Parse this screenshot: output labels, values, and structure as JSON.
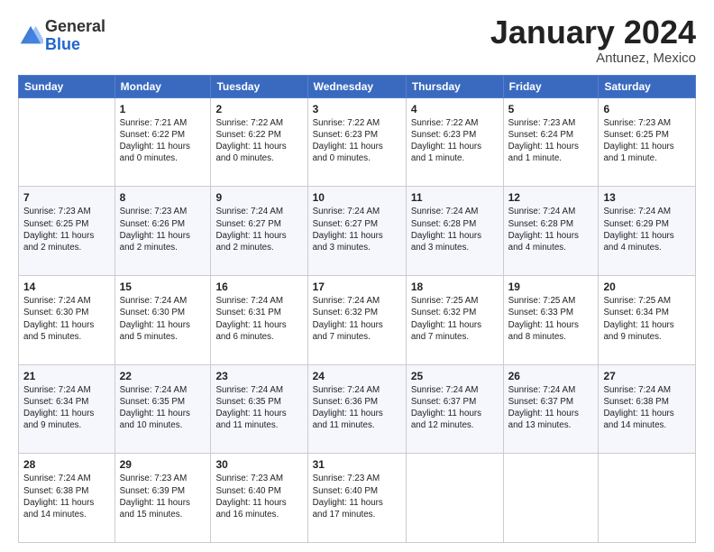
{
  "logo": {
    "general": "General",
    "blue": "Blue"
  },
  "title": "January 2024",
  "location": "Antunez, Mexico",
  "days_of_week": [
    "Sunday",
    "Monday",
    "Tuesday",
    "Wednesday",
    "Thursday",
    "Friday",
    "Saturday"
  ],
  "weeks": [
    [
      {
        "day": "",
        "info": ""
      },
      {
        "day": "1",
        "info": "Sunrise: 7:21 AM\nSunset: 6:22 PM\nDaylight: 11 hours\nand 0 minutes."
      },
      {
        "day": "2",
        "info": "Sunrise: 7:22 AM\nSunset: 6:22 PM\nDaylight: 11 hours\nand 0 minutes."
      },
      {
        "day": "3",
        "info": "Sunrise: 7:22 AM\nSunset: 6:23 PM\nDaylight: 11 hours\nand 0 minutes."
      },
      {
        "day": "4",
        "info": "Sunrise: 7:22 AM\nSunset: 6:23 PM\nDaylight: 11 hours\nand 1 minute."
      },
      {
        "day": "5",
        "info": "Sunrise: 7:23 AM\nSunset: 6:24 PM\nDaylight: 11 hours\nand 1 minute."
      },
      {
        "day": "6",
        "info": "Sunrise: 7:23 AM\nSunset: 6:25 PM\nDaylight: 11 hours\nand 1 minute."
      }
    ],
    [
      {
        "day": "7",
        "info": "Sunrise: 7:23 AM\nSunset: 6:25 PM\nDaylight: 11 hours\nand 2 minutes."
      },
      {
        "day": "8",
        "info": "Sunrise: 7:23 AM\nSunset: 6:26 PM\nDaylight: 11 hours\nand 2 minutes."
      },
      {
        "day": "9",
        "info": "Sunrise: 7:24 AM\nSunset: 6:27 PM\nDaylight: 11 hours\nand 2 minutes."
      },
      {
        "day": "10",
        "info": "Sunrise: 7:24 AM\nSunset: 6:27 PM\nDaylight: 11 hours\nand 3 minutes."
      },
      {
        "day": "11",
        "info": "Sunrise: 7:24 AM\nSunset: 6:28 PM\nDaylight: 11 hours\nand 3 minutes."
      },
      {
        "day": "12",
        "info": "Sunrise: 7:24 AM\nSunset: 6:28 PM\nDaylight: 11 hours\nand 4 minutes."
      },
      {
        "day": "13",
        "info": "Sunrise: 7:24 AM\nSunset: 6:29 PM\nDaylight: 11 hours\nand 4 minutes."
      }
    ],
    [
      {
        "day": "14",
        "info": "Sunrise: 7:24 AM\nSunset: 6:30 PM\nDaylight: 11 hours\nand 5 minutes."
      },
      {
        "day": "15",
        "info": "Sunrise: 7:24 AM\nSunset: 6:30 PM\nDaylight: 11 hours\nand 5 minutes."
      },
      {
        "day": "16",
        "info": "Sunrise: 7:24 AM\nSunset: 6:31 PM\nDaylight: 11 hours\nand 6 minutes."
      },
      {
        "day": "17",
        "info": "Sunrise: 7:24 AM\nSunset: 6:32 PM\nDaylight: 11 hours\nand 7 minutes."
      },
      {
        "day": "18",
        "info": "Sunrise: 7:25 AM\nSunset: 6:32 PM\nDaylight: 11 hours\nand 7 minutes."
      },
      {
        "day": "19",
        "info": "Sunrise: 7:25 AM\nSunset: 6:33 PM\nDaylight: 11 hours\nand 8 minutes."
      },
      {
        "day": "20",
        "info": "Sunrise: 7:25 AM\nSunset: 6:34 PM\nDaylight: 11 hours\nand 9 minutes."
      }
    ],
    [
      {
        "day": "21",
        "info": "Sunrise: 7:24 AM\nSunset: 6:34 PM\nDaylight: 11 hours\nand 9 minutes."
      },
      {
        "day": "22",
        "info": "Sunrise: 7:24 AM\nSunset: 6:35 PM\nDaylight: 11 hours\nand 10 minutes."
      },
      {
        "day": "23",
        "info": "Sunrise: 7:24 AM\nSunset: 6:35 PM\nDaylight: 11 hours\nand 11 minutes."
      },
      {
        "day": "24",
        "info": "Sunrise: 7:24 AM\nSunset: 6:36 PM\nDaylight: 11 hours\nand 11 minutes."
      },
      {
        "day": "25",
        "info": "Sunrise: 7:24 AM\nSunset: 6:37 PM\nDaylight: 11 hours\nand 12 minutes."
      },
      {
        "day": "26",
        "info": "Sunrise: 7:24 AM\nSunset: 6:37 PM\nDaylight: 11 hours\nand 13 minutes."
      },
      {
        "day": "27",
        "info": "Sunrise: 7:24 AM\nSunset: 6:38 PM\nDaylight: 11 hours\nand 14 minutes."
      }
    ],
    [
      {
        "day": "28",
        "info": "Sunrise: 7:24 AM\nSunset: 6:38 PM\nDaylight: 11 hours\nand 14 minutes."
      },
      {
        "day": "29",
        "info": "Sunrise: 7:23 AM\nSunset: 6:39 PM\nDaylight: 11 hours\nand 15 minutes."
      },
      {
        "day": "30",
        "info": "Sunrise: 7:23 AM\nSunset: 6:40 PM\nDaylight: 11 hours\nand 16 minutes."
      },
      {
        "day": "31",
        "info": "Sunrise: 7:23 AM\nSunset: 6:40 PM\nDaylight: 11 hours\nand 17 minutes."
      },
      {
        "day": "",
        "info": ""
      },
      {
        "day": "",
        "info": ""
      },
      {
        "day": "",
        "info": ""
      }
    ]
  ]
}
